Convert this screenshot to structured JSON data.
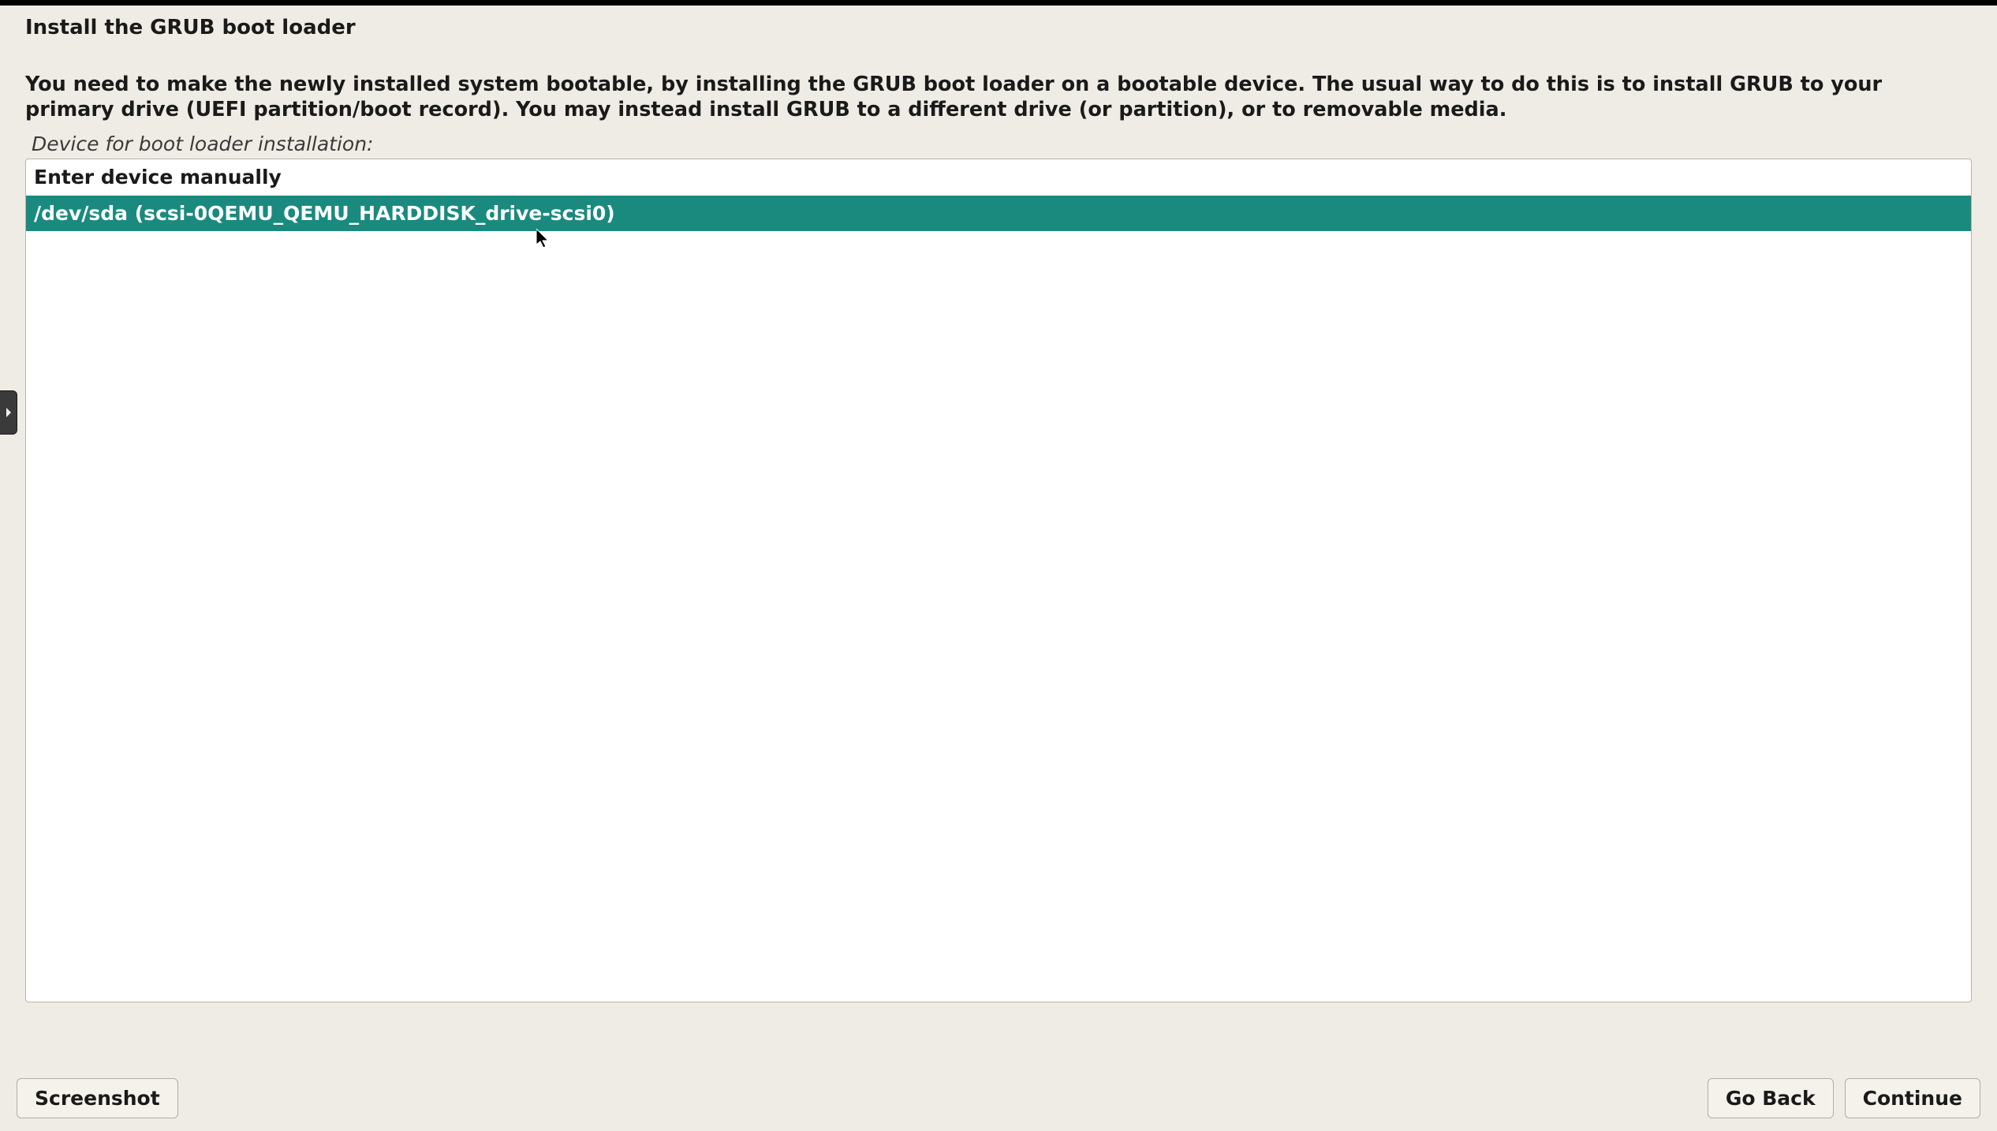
{
  "header": {
    "title": "Install the GRUB boot loader"
  },
  "main": {
    "description": "You need to make the newly installed system bootable, by installing the GRUB boot loader on a bootable device. The usual way to do this is to install GRUB to your primary drive (UEFI partition/boot record). You may instead install GRUB to a different drive (or partition), or to removable media.",
    "prompt": "Device for boot loader installation:",
    "items": [
      {
        "label": "Enter device manually",
        "selected": false
      },
      {
        "label": "/dev/sda  (scsi-0QEMU_QEMU_HARDDISK_drive-scsi0)",
        "selected": true
      }
    ]
  },
  "footer": {
    "screenshot": "Screenshot",
    "go_back": "Go Back",
    "continue": "Continue"
  }
}
